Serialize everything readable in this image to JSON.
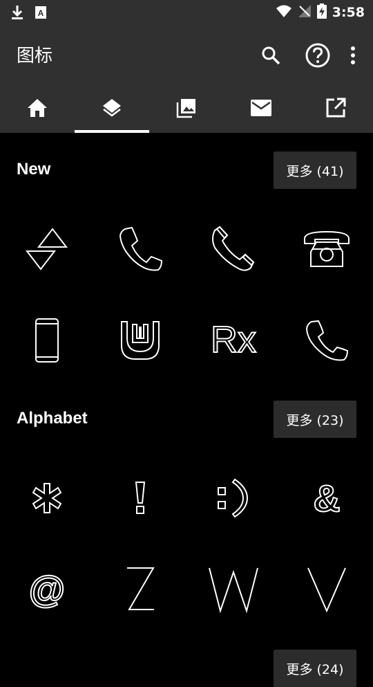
{
  "status_bar": {
    "time": "3:58"
  },
  "app_bar": {
    "title": "图标"
  },
  "tabs": [
    {
      "name": "home"
    },
    {
      "name": "layers"
    },
    {
      "name": "photo-library"
    },
    {
      "name": "mail"
    },
    {
      "name": "open-in-new"
    }
  ],
  "sections": [
    {
      "title": "New",
      "more_label": "更多 (41)"
    },
    {
      "title": "Alphabet",
      "more_label": "更多 (23)"
    },
    {
      "title": "",
      "more_label": "更多 (24)"
    }
  ],
  "icons": {
    "new": [
      "swap-vertical-triangles-icon",
      "phone-icon",
      "phone-hangup-icon",
      "rotary-telephone-icon",
      "smartphone-icon",
      "wattpad-icon",
      "prescription-rx-icon",
      "phone-outline-icon"
    ],
    "alphabet": [
      "asterisk-icon",
      "exclamation-icon",
      "smiley-colon-paren-icon",
      "ampersand-icon",
      "at-sign-icon",
      "letter-z-icon",
      "letter-w-icon",
      "letter-v-icon"
    ]
  },
  "glyphs": {
    "rx": "Rx",
    "exclamation": "!",
    "ampersand": "&",
    "at": "@",
    "z": "Z",
    "w": "W",
    "v": "V"
  }
}
